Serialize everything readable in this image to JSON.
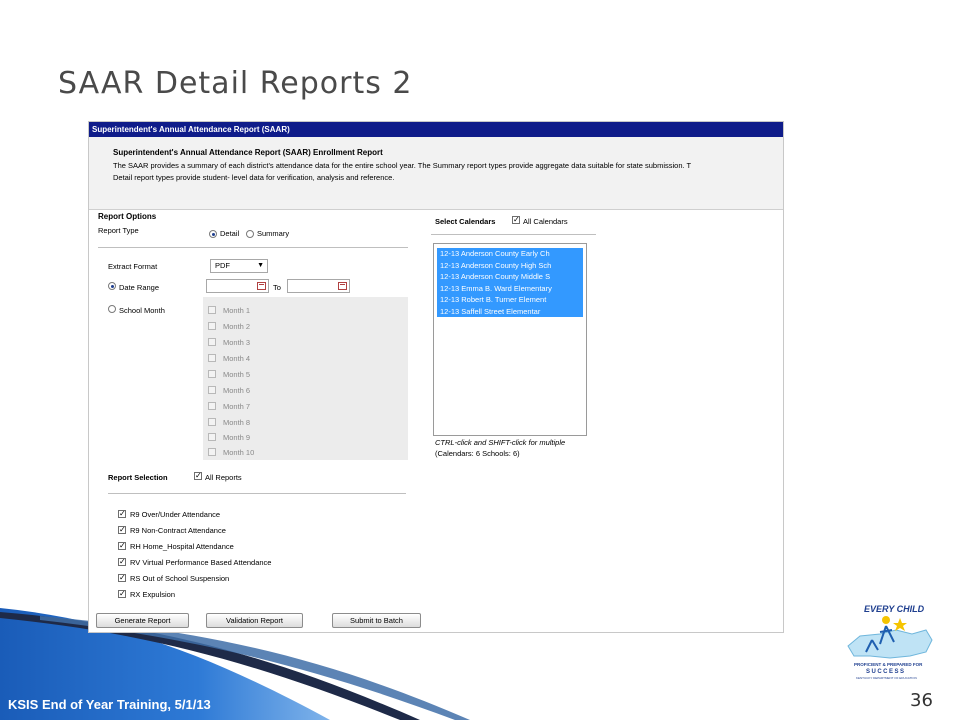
{
  "slide": {
    "title": "SAAR Detail Reports 2",
    "footer": "KSIS End of Year Training, 5/1/13",
    "page_number": "36"
  },
  "window": {
    "title": "Superintendent's Annual Attendance Report (SAAR)"
  },
  "description": {
    "heading": "Superintendent's Annual Attendance Report (SAAR) Enrollment Report",
    "line1": "The SAAR provides a summary of each district's attendance data for the entire school year. The Summary report types provide aggregate data suitable for state submission. T",
    "line2": "Detail report types provide student- level data for verification, analysis and reference."
  },
  "report_options": {
    "heading": "Report Options",
    "report_type_label": "Report Type",
    "detail_label": "Detail",
    "summary_label": "Summary",
    "selected_type": "Detail",
    "extract_format_label": "Extract Format",
    "extract_format_value": "PDF",
    "date_range_label": "Date Range",
    "to_label": "To",
    "date_from_value": "",
    "date_to_value": "",
    "school_month_label": "School Month",
    "months": [
      "Month 1",
      "Month 2",
      "Month 3",
      "Month 4",
      "Month 5",
      "Month 6",
      "Month 7",
      "Month 8",
      "Month 9",
      "Month 10"
    ]
  },
  "calendars": {
    "heading": "Select Calendars",
    "all_label": "All Calendars",
    "all_checked": true,
    "items": [
      "12-13 Anderson County Early Ch",
      "12-13 Anderson County High Sch",
      "12-13 Anderson County Middle S",
      "12-13 Emma B. Ward Elementary",
      "12-13 Robert B. Turner Element",
      "12-13 Saffell Street Elementar"
    ],
    "hint": "CTRL-click and SHIFT-click for multiple",
    "counts": "(Calendars: 6  Schools: 6)"
  },
  "report_selection": {
    "heading": "Report Selection",
    "all_label": "All Reports",
    "all_checked": true,
    "reports": [
      "R9 Over/Under Attendance",
      "R9 Non-Contract Attendance",
      "RH Home_Hospital Attendance",
      "RV Virtual Performance Based Attendance",
      "RS Out of School Suspension",
      "RX Expulsion"
    ]
  },
  "buttons": {
    "generate": "Generate Report",
    "validation": "Validation Report",
    "submit": "Submit to Batch"
  },
  "logo": {
    "top_text": "EVERY CHILD",
    "middle_text": "PROFICIENT & PREPARED FOR",
    "success_text": "SUCCESS",
    "bottom_text": "KENTUCKY DEPARTMENT OF EDUCATION"
  },
  "colors": {
    "title_bar": "#0f1c8a",
    "selection": "#3399ff",
    "footer_band": "#1f5fb0"
  }
}
